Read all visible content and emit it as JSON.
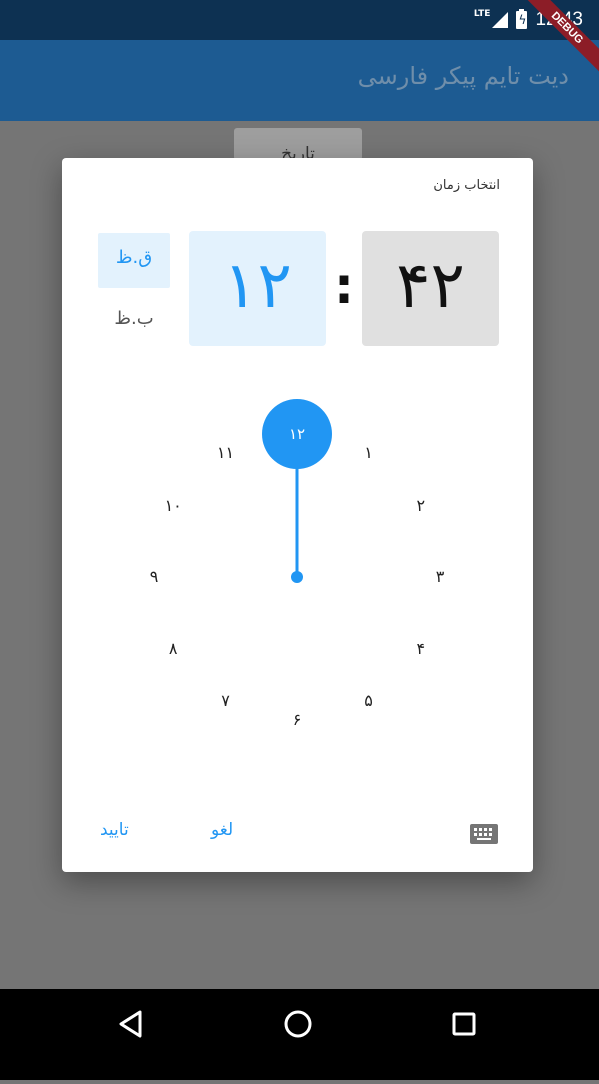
{
  "status_bar": {
    "network": "LTE",
    "time": "12:43"
  },
  "debug_banner": "DEBUG",
  "app_bar": {
    "title": "دیت تایم پیکر فارسی"
  },
  "background": {
    "date_button_label": "تاریخ"
  },
  "dialog": {
    "title": "انتخاب زمان",
    "hour": "۱۲",
    "separator": ":",
    "minute": "۴۲",
    "period_am": "ق.ظ",
    "period_pm": "ب.ظ",
    "selected_hour": 12,
    "dial_labels": [
      "۱۲",
      "۱",
      "۲",
      "۳",
      "۴",
      "۵",
      "۶",
      "۷",
      "۸",
      "۹",
      "۱۰",
      "۱۱"
    ],
    "cancel_label": "لغو",
    "confirm_label": "تایید",
    "accent_color": "#2196f3"
  },
  "navigation": {
    "back_icon": "back-triangle-icon",
    "home_icon": "home-circle-icon",
    "recents_icon": "recents-square-icon"
  }
}
